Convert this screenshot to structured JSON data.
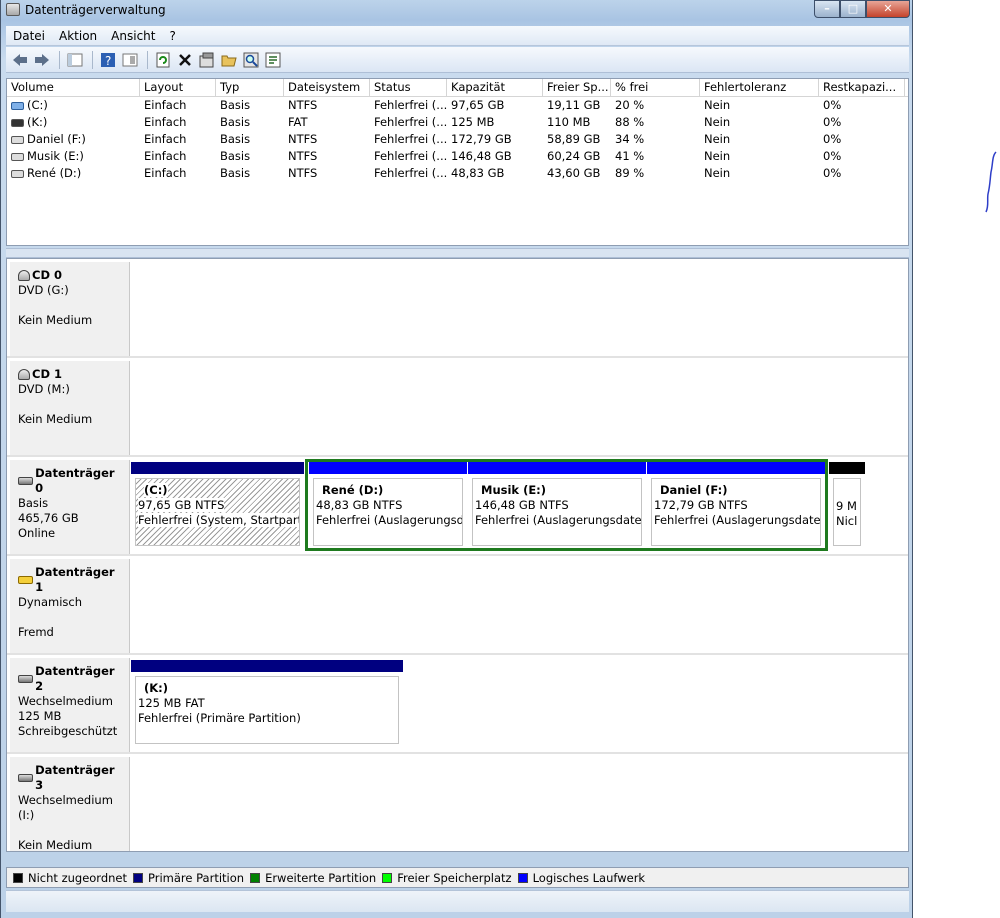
{
  "window": {
    "title": "Datenträgerverwaltung",
    "min": "–",
    "max": "□",
    "close": "✕"
  },
  "menu": [
    "Datei",
    "Aktion",
    "Ansicht",
    "?"
  ],
  "toolbar_icons": [
    "back-icon",
    "forward-icon",
    "console-tree-icon",
    "help-icon",
    "properties-icon",
    "refresh-icon",
    "delete-icon",
    "settings-icon",
    "open-icon",
    "find-icon",
    "export-icon"
  ],
  "volumes": {
    "columns": [
      "Volume",
      "Layout",
      "Typ",
      "Dateisystem",
      "Status",
      "Kapazität",
      "Freier Sp...",
      "% frei",
      "Fehlertoleranz",
      "Restkapazi..."
    ],
    "rows": [
      [
        "(C:)",
        "Einfach",
        "Basis",
        "NTFS",
        "Fehlerfrei (...",
        "97,65 GB",
        "19,11 GB",
        "20 %",
        "Nein",
        "0%"
      ],
      [
        "(K:)",
        "Einfach",
        "Basis",
        "FAT",
        "Fehlerfrei (...",
        "125 MB",
        "110 MB",
        "88 %",
        "Nein",
        "0%"
      ],
      [
        "Daniel (F:)",
        "Einfach",
        "Basis",
        "NTFS",
        "Fehlerfrei (...",
        "172,79 GB",
        "58,89 GB",
        "34 %",
        "Nein",
        "0%"
      ],
      [
        "Musik (E:)",
        "Einfach",
        "Basis",
        "NTFS",
        "Fehlerfrei (...",
        "146,48 GB",
        "60,24 GB",
        "41 %",
        "Nein",
        "0%"
      ],
      [
        "René (D:)",
        "Einfach",
        "Basis",
        "NTFS",
        "Fehlerfrei (...",
        "48,83 GB",
        "43,60 GB",
        "89 %",
        "Nein",
        "0%"
      ]
    ]
  },
  "disks": {
    "cd0": {
      "name": "CD 0",
      "l1": "DVD (G:)",
      "l3": "Kein Medium"
    },
    "cd1": {
      "name": "CD 1",
      "l1": "DVD (M:)",
      "l3": "Kein Medium"
    },
    "d0": {
      "name": "Datenträger 0",
      "l1": "Basis",
      "l2": "465,76 GB",
      "l3": "Online",
      "p_c": {
        "name": "(C:)",
        "size": "97,65 GB NTFS",
        "status": "Fehlerfrei (System, Startpartition"
      },
      "p_d": {
        "name": "René  (D:)",
        "size": "48,83 GB NTFS",
        "status": "Fehlerfrei (Auslagerungsdatei"
      },
      "p_e": {
        "name": "Musik  (E:)",
        "size": "146,48 GB NTFS",
        "status": "Fehlerfrei (Auslagerungsdatei, L"
      },
      "p_f": {
        "name": "Daniel  (F:)",
        "size": "172,79 GB NTFS",
        "status": "Fehlerfrei (Auslagerungsdatei, L"
      },
      "p_u": {
        "size": "9 M",
        "status": "Nicl"
      }
    },
    "d1": {
      "name": "Datenträger 1",
      "l1": "Dynamisch",
      "l3": "Fremd"
    },
    "d2": {
      "name": "Datenträger 2",
      "l1": "Wechselmedium",
      "l2": "125 MB",
      "l3": "Schreibgeschützt",
      "p_k": {
        "name": "(K:)",
        "size": "125 MB FAT",
        "status": "Fehlerfrei (Primäre Partition)"
      }
    },
    "d3": {
      "name": "Datenträger 3",
      "l1": "Wechselmedium (I:)",
      "l3": "Kein Medium"
    }
  },
  "legend": [
    {
      "label": "Nicht zugeordnet",
      "color": "#000000"
    },
    {
      "label": "Primäre Partition",
      "color": "#000080"
    },
    {
      "label": "Erweiterte Partition",
      "color": "#008000"
    },
    {
      "label": "Freier Speicherplatz",
      "color": "#00ff00"
    },
    {
      "label": "Logisches Laufwerk",
      "color": "#0000ff"
    }
  ]
}
